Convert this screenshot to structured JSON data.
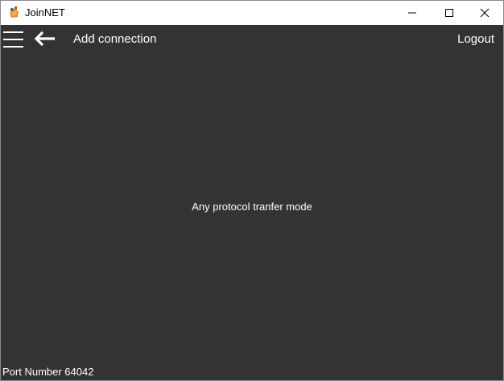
{
  "window": {
    "title": "JoinNET",
    "app_icon": "joinnet-logo-icon",
    "controls": [
      "minimize-icon",
      "maximize-icon",
      "close-icon"
    ]
  },
  "header": {
    "menu_icon": "hamburger-menu-icon",
    "back_icon": "back-arrow-icon",
    "title": "Add connection",
    "logout_label": "Logout"
  },
  "main": {
    "mode_text": "Any protocol tranfer mode"
  },
  "footer": {
    "port_text": "Port Number 64042"
  },
  "colors": {
    "background": "#333333",
    "titlebar": "#ffffff",
    "text": "#ffffff"
  }
}
